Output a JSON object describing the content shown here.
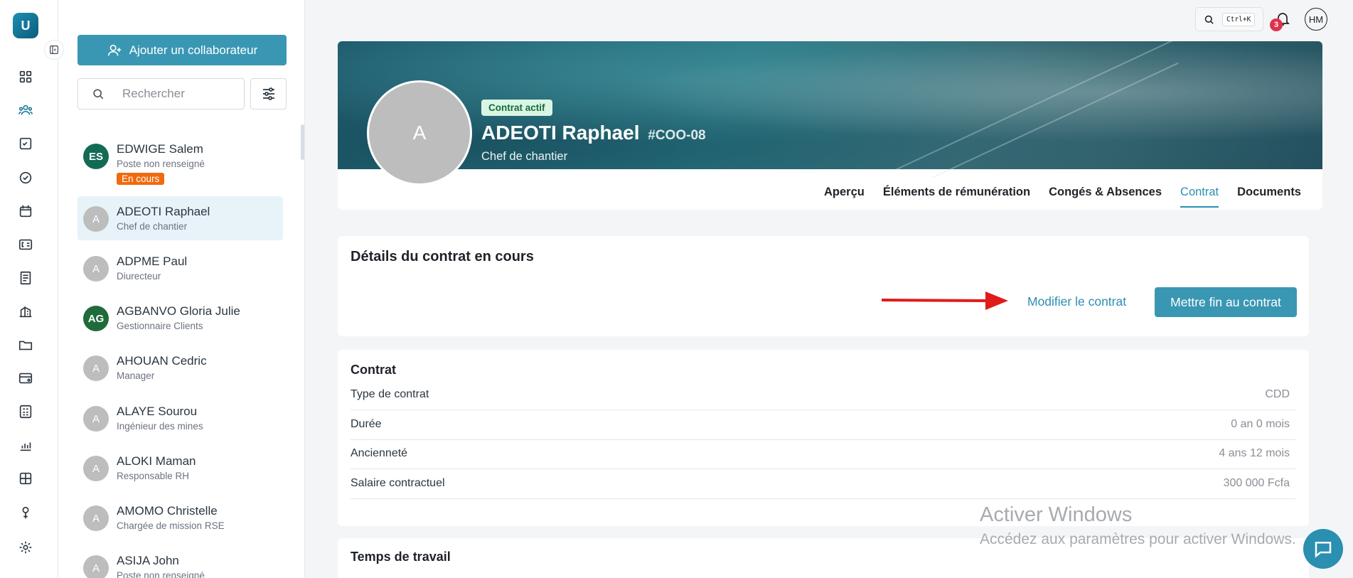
{
  "app": {
    "logo_letter": "U"
  },
  "rail": {
    "icons": [
      "dashboard-icon",
      "people-icon",
      "tasks-icon",
      "check-circle-icon",
      "calendar-icon",
      "payroll-icon",
      "document-icon",
      "building-icon",
      "folder-icon",
      "card-icon",
      "calculator-icon",
      "chart-icon",
      "table-icon",
      "award-icon",
      "settings-icon"
    ]
  },
  "panel": {
    "add_button": "Ajouter un collaborateur",
    "search_placeholder": "Rechercher",
    "people": [
      {
        "initials": "ES",
        "name": "EDWIGE Salem",
        "role": "Poste non renseigné",
        "badge": "En cours"
      },
      {
        "initials": "A",
        "name": "ADEOTI Raphael",
        "role": "Chef de chantier",
        "badge": ""
      },
      {
        "initials": "A",
        "name": "ADPME Paul",
        "role": "Diurecteur",
        "badge": ""
      },
      {
        "initials": "AG",
        "name": "AGBANVO Gloria Julie",
        "role": "Gestionnaire Clients",
        "badge": ""
      },
      {
        "initials": "A",
        "name": "AHOUAN Cedric",
        "role": "Manager",
        "badge": ""
      },
      {
        "initials": "A",
        "name": "ALAYE Sourou",
        "role": "Ingénieur des mines",
        "badge": ""
      },
      {
        "initials": "A",
        "name": "ALOKI Maman",
        "role": "Responsable RH",
        "badge": ""
      },
      {
        "initials": "A",
        "name": "AMOMO Christelle",
        "role": "Chargée de mission RSE",
        "badge": ""
      },
      {
        "initials": "A",
        "name": "ASIJA John",
        "role": "Poste non renseigné",
        "badge": ""
      }
    ]
  },
  "topbar": {
    "shortcut": "Ctrl+K",
    "notifications": "3",
    "user_initials": "HM"
  },
  "profile": {
    "avatar_letter": "A",
    "contract_status": "Contrat actif",
    "name": "ADEOTI Raphael",
    "code": "#COO-08",
    "role": "Chef de chantier",
    "tabs": [
      "Aperçu",
      "Éléments de rémunération",
      "Congés & Absences",
      "Contrat",
      "Documents"
    ],
    "active_tab": "Contrat"
  },
  "details": {
    "title": "Détails du contrat en cours",
    "modify": "Modifier le contrat",
    "end": "Mettre fin au contrat"
  },
  "contract": {
    "title": "Contrat",
    "rows": [
      {
        "label": "Type de contrat",
        "value": "CDD"
      },
      {
        "label": "Durée",
        "value": "0 an 0 mois"
      },
      {
        "label": "Ancienneté",
        "value": "4 ans 12 mois"
      },
      {
        "label": "Salaire contractuel",
        "value": "300 000 Fcfa"
      }
    ]
  },
  "worktime": {
    "title": "Temps de travail"
  },
  "watermark": {
    "line1": "Activer Windows",
    "line2": "Accédez aux paramètres pour activer Windows."
  },
  "colors": {
    "accent": "#3a97b3",
    "badge": "#f06a0f",
    "chip_bg": "#d9f6e4",
    "arrow": "#e01b1b"
  }
}
